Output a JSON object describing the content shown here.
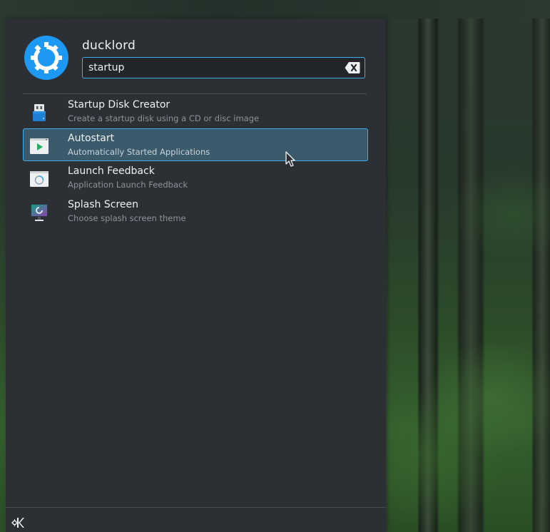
{
  "user": {
    "name": "ducklord"
  },
  "search": {
    "value": "startup"
  },
  "results": [
    {
      "title": "Startup Disk Creator",
      "subtitle": "Create a startup disk using a CD or disc image",
      "icon": "usb-drive-icon",
      "active": false
    },
    {
      "title": "Autostart",
      "subtitle": "Automatically Started Applications",
      "icon": "autostart-icon",
      "active": true
    },
    {
      "title": "Launch Feedback",
      "subtitle": "Application Launch Feedback",
      "icon": "launch-feedback-icon",
      "active": false
    },
    {
      "title": "Splash Screen",
      "subtitle": "Choose splash screen theme",
      "icon": "splash-screen-icon",
      "active": false
    }
  ],
  "colors": {
    "accent": "#3daee9",
    "panel": "#2c3035",
    "highlight": "#3b5a6b",
    "avatar": "#1d99f3"
  },
  "icons": {
    "clear": "backspace-clear-icon",
    "logo": "kde-logo-icon",
    "avatar": "kde-gear-avatar-icon"
  }
}
